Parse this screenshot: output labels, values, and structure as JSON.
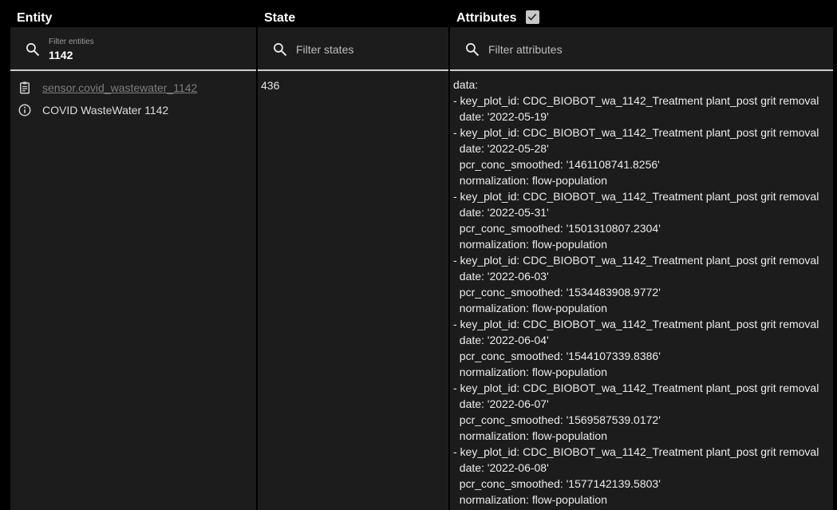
{
  "headers": {
    "entity": "Entity",
    "state": "State",
    "attributes": "Attributes"
  },
  "attributes_checkbox_checked": true,
  "filters": {
    "entity": {
      "label": "Filter entities",
      "value": "1142"
    },
    "state": {
      "placeholder": "Filter states"
    },
    "attributes": {
      "placeholder": "Filter attributes"
    }
  },
  "entity": {
    "entity_id": "sensor.covid_wastewater_1142",
    "friendly_name": "COVID WasteWater 1142"
  },
  "state": "436",
  "attribute_lines": [
    "data:",
    "- key_plot_id: CDC_BIOBOT_wa_1142_Treatment plant_post grit removal",
    "  date: '2022-05-19'",
    "- key_plot_id: CDC_BIOBOT_wa_1142_Treatment plant_post grit removal",
    "  date: '2022-05-28'",
    "  pcr_conc_smoothed: '1461108741.8256'",
    "  normalization: flow-population",
    "- key_plot_id: CDC_BIOBOT_wa_1142_Treatment plant_post grit removal",
    "  date: '2022-05-31'",
    "  pcr_conc_smoothed: '1501310807.2304'",
    "  normalization: flow-population",
    "- key_plot_id: CDC_BIOBOT_wa_1142_Treatment plant_post grit removal",
    "  date: '2022-06-03'",
    "  pcr_conc_smoothed: '1534483908.9772'",
    "  normalization: flow-population",
    "- key_plot_id: CDC_BIOBOT_wa_1142_Treatment plant_post grit removal",
    "  date: '2022-06-04'",
    "  pcr_conc_smoothed: '1544107339.8386'",
    "  normalization: flow-population",
    "- key_plot_id: CDC_BIOBOT_wa_1142_Treatment plant_post grit removal",
    "  date: '2022-06-07'",
    "  pcr_conc_smoothed: '1569587539.0172'",
    "  normalization: flow-population",
    "- key_plot_id: CDC_BIOBOT_wa_1142_Treatment plant_post grit removal",
    "  date: '2022-06-08'",
    "  pcr_conc_smoothed: '1577142139.5803'",
    "  normalization: flow-population"
  ],
  "colors": {
    "background": "#000000",
    "panel": "#1c1c1c",
    "link": "#7d7d7d",
    "text": "#e1e1e1"
  },
  "icons": {
    "search": "search-icon",
    "clipboard": "clipboard-icon",
    "info": "info-icon",
    "checkbox": "checkbox-checked-icon"
  }
}
